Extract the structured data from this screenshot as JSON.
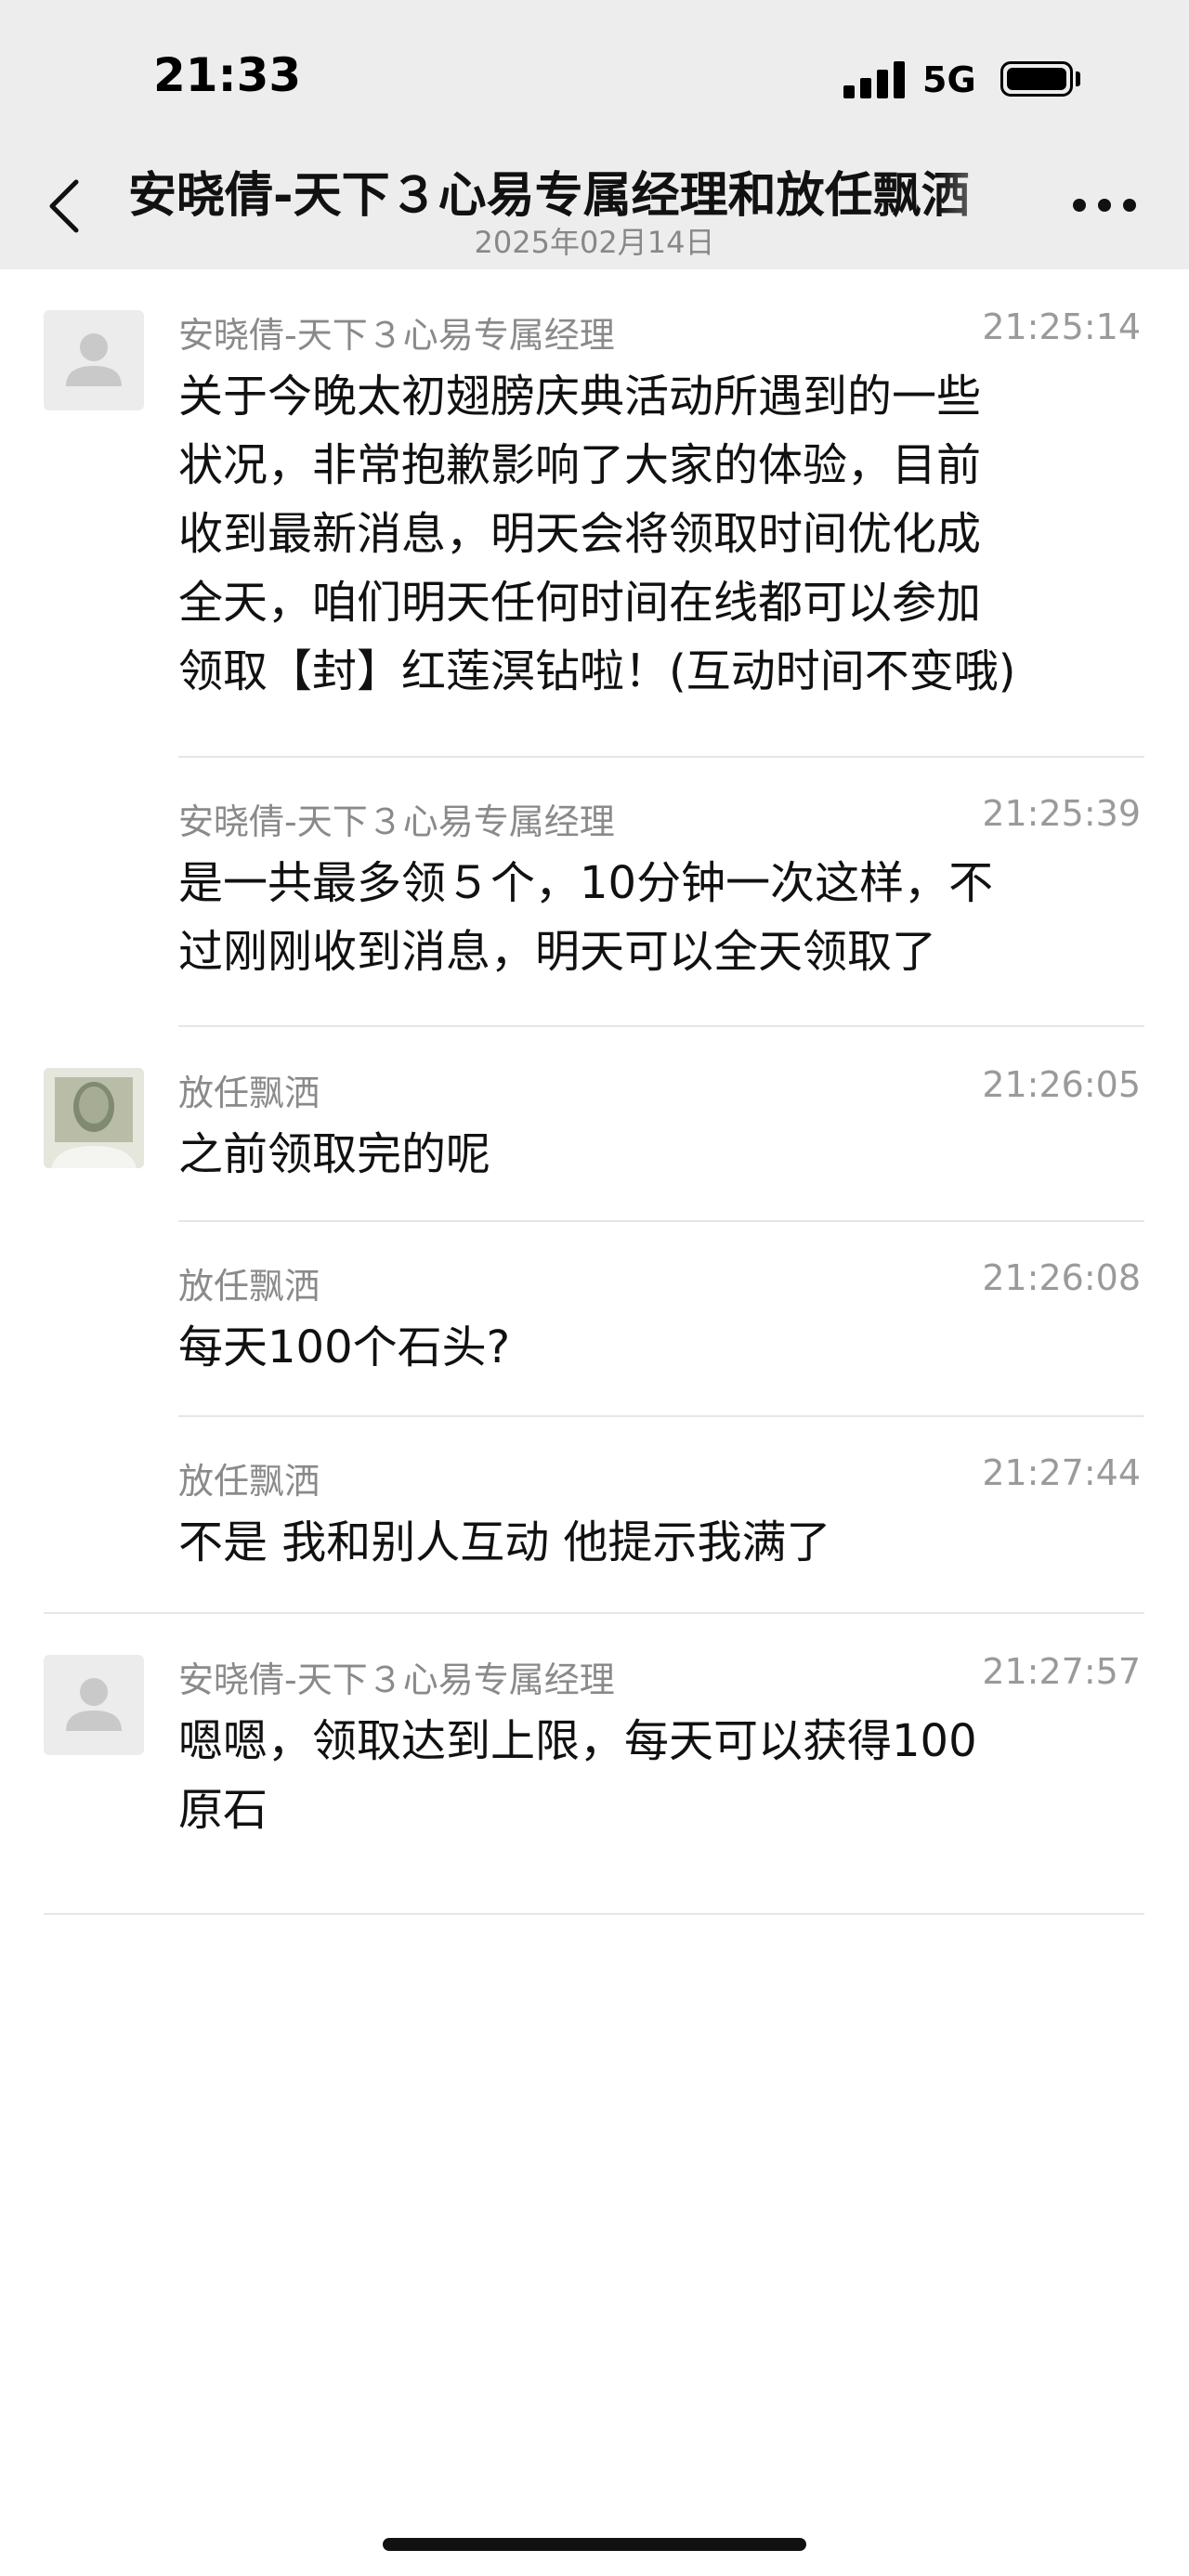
{
  "status_bar": {
    "time": "21:33",
    "network": "5G"
  },
  "header": {
    "title": "安晓倩-天下３心易专属经理和放任飘洒",
    "date": "2025年02月14日"
  },
  "messages": [
    {
      "sender": "安晓倩-天下３心易专属经理",
      "time": "21:25:14",
      "lines": [
        "关于今晚太初翅膀庆典活动所遇到的一些",
        "状况，非常抱歉影响了大家的体验，目前",
        "收到最新消息，明天会将领取时间优化成",
        "全天，咱们明天任何时间在线都可以参加",
        "领取【封】红莲溟钻啦！(互动时间不变哦)"
      ]
    },
    {
      "sender": "安晓倩-天下３心易专属经理",
      "time": "21:25:39",
      "lines": [
        "是一共最多领５个，10分钟一次这样，不",
        "过刚刚收到消息，明天可以全天领取了"
      ]
    },
    {
      "sender": "放任飘洒",
      "time": "21:26:05",
      "lines": [
        "之前领取完的呢"
      ]
    },
    {
      "sender": "放任飘洒",
      "time": "21:26:08",
      "lines": [
        "每天100个石头?"
      ]
    },
    {
      "sender": "放任飘洒",
      "time": "21:27:44",
      "lines": [
        "不是 我和别人互动 他提示我满了"
      ]
    },
    {
      "sender": "安晓倩-天下３心易专属经理",
      "time": "21:27:57",
      "lines": [
        "嗯嗯，领取达到上限，每天可以获得100",
        "原石"
      ]
    }
  ]
}
